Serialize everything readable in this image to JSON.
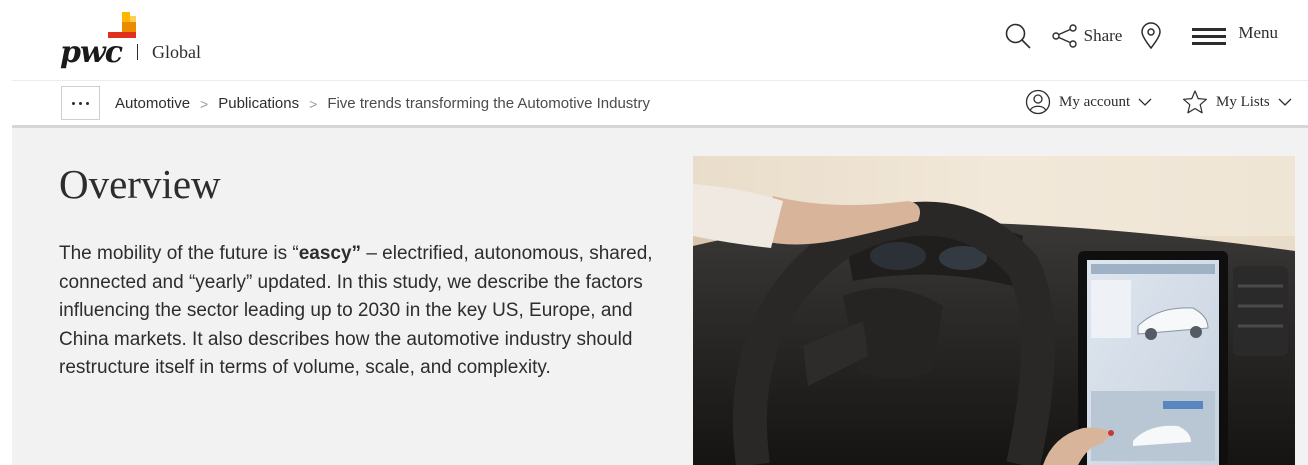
{
  "brand": {
    "logo_text": "pwc",
    "region": "Global",
    "colors": {
      "logo_orange": "#e0301e",
      "logo_amber": "#eb8c00",
      "logo_gold": "#ffb600"
    }
  },
  "header": {
    "search_icon": "search-icon",
    "share_label": "Share",
    "location_icon": "location-pin-icon",
    "menu_label": "Menu"
  },
  "breadcrumb": {
    "more_icon": "ellipsis-icon",
    "items": [
      {
        "label": "Automotive"
      },
      {
        "label": "Publications"
      },
      {
        "label": "Five trends transforming the Automotive Industry"
      }
    ],
    "separator": ">"
  },
  "account": {
    "my_account_label": "My account",
    "my_lists_label": "My Lists"
  },
  "main": {
    "title": "Overview",
    "body_pre": "The mobility of the future is “",
    "body_bold": "eascy”",
    "body_post": " – electrified, autonomous, shared, connected and “yearly” updated. In this study, we describe the factors influencing the sector leading up to 2030 in the key US, Europe, and China markets. It also describes how the automotive industry should restructure itself in terms of volume, scale, and complexity.",
    "background": "#f2f2f2"
  }
}
